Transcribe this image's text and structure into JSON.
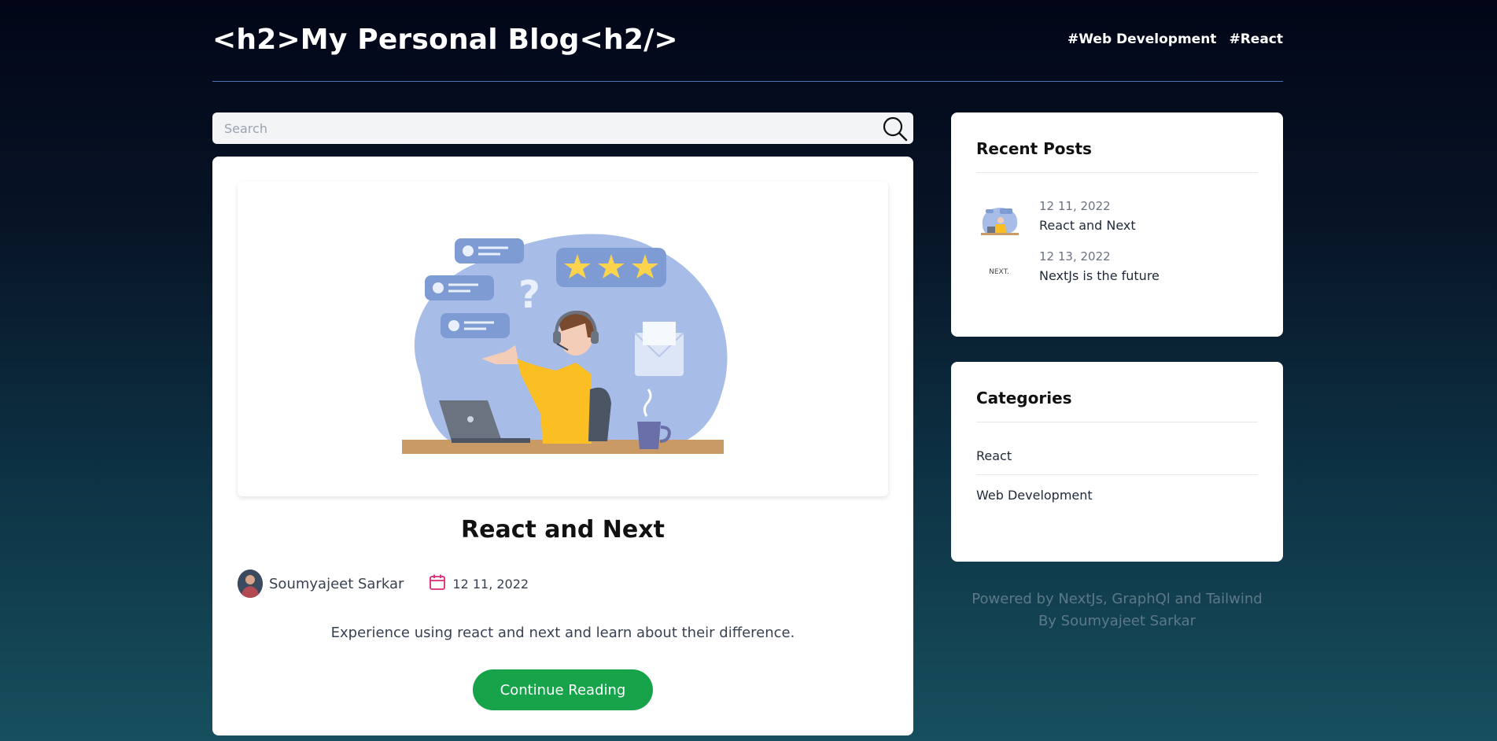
{
  "header": {
    "site_title": "<h2>My Personal Blog<h2/>",
    "nav": [
      {
        "label": "#Web Development"
      },
      {
        "label": "#React"
      }
    ]
  },
  "search": {
    "placeholder": "Search",
    "value": "",
    "icon": "search-icon"
  },
  "post": {
    "title": "React and Next",
    "author": "Soumyajeet Sarkar",
    "date": "12 11, 2022",
    "excerpt": "Experience using react and next and learn about their difference.",
    "button_label": "Continue Reading",
    "icons": {
      "date": "calendar-icon"
    }
  },
  "recent_posts": {
    "title": "Recent Posts",
    "items": [
      {
        "date": "12 11, 2022",
        "title": "React and Next",
        "thumb": "support-illustration-thumbnail"
      },
      {
        "date": "12 13, 2022",
        "title": "NextJs is the future",
        "thumb": "nextjs-logo-thumbnail",
        "thumb_text": "NEXT."
      }
    ]
  },
  "categories": {
    "title": "Categories",
    "items": [
      {
        "label": "React"
      },
      {
        "label": "Web Development"
      }
    ]
  },
  "footer": {
    "line1": "Powered by NextJs, GraphQl and Tailwind",
    "line2": "By Soumyajeet Sarkar"
  },
  "colors": {
    "accent_green": "#16a34a",
    "calendar_pink": "#db2777",
    "header_divider": "#4a6fb5"
  }
}
